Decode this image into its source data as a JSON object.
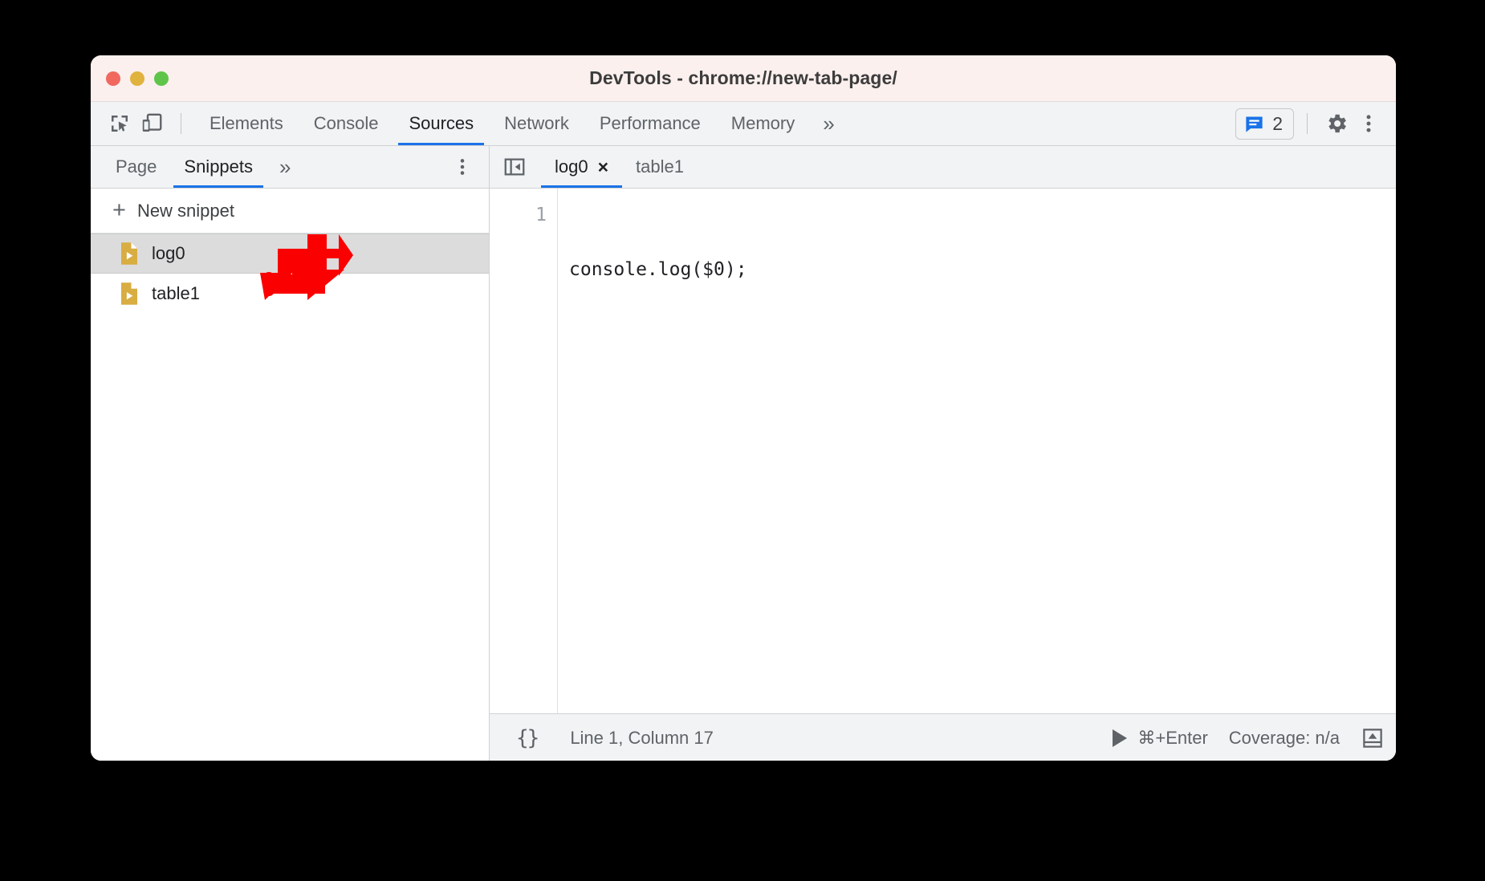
{
  "window": {
    "title": "DevTools - chrome://new-tab-page/",
    "traffic_lights": [
      "close",
      "minimize",
      "maximize"
    ],
    "colors": {
      "titlebar_bg": "#fbf0ee",
      "toolbar_bg": "#f1f3f4",
      "accent": "#1a73e8",
      "selection_bg": "#dcdcdc",
      "snippet_icon": "#d8ad42",
      "annotation_arrow": "#fa0000"
    }
  },
  "toolbar": {
    "inspect_icon": "inspect-element-icon",
    "device_icon": "device-toolbar-icon",
    "tabs": [
      {
        "label": "Elements",
        "active": false
      },
      {
        "label": "Console",
        "active": false
      },
      {
        "label": "Sources",
        "active": true
      },
      {
        "label": "Network",
        "active": false
      },
      {
        "label": "Performance",
        "active": false
      },
      {
        "label": "Memory",
        "active": false
      }
    ],
    "more_tabs_label": "»",
    "message_count": "2",
    "message_icon": "console-message-icon",
    "settings_icon": "gear-icon",
    "more_options_icon": "three-dot-menu-icon"
  },
  "navigator": {
    "tabs": [
      {
        "label": "Page",
        "active": false
      },
      {
        "label": "Snippets",
        "active": true
      }
    ],
    "more_tabs_label": "»",
    "menu_icon": "three-dot-menu-icon",
    "new_snippet_label": "New snippet",
    "new_snippet_plus": "+",
    "snippets": [
      {
        "label": "log0",
        "selected": true
      },
      {
        "label": "table1",
        "selected": false
      }
    ]
  },
  "editor": {
    "collapse_icon": "collapse-sidebar-icon",
    "tabs": [
      {
        "label": "log0",
        "active": true,
        "closable": true,
        "close_glyph": "×"
      },
      {
        "label": "table1",
        "active": false,
        "closable": false,
        "close_glyph": ""
      }
    ],
    "lines": [
      {
        "number": "1",
        "text": "console.log($0);"
      }
    ]
  },
  "statusbar": {
    "pretty_print_label": "{}",
    "cursor_position": "Line 1, Column 17",
    "run_icon": "play-icon",
    "run_shortcut": "⌘+Enter",
    "coverage_label": "Coverage: n/a",
    "drawer_icon": "drawer-toggle-icon"
  },
  "annotation": {
    "arrow": "red-arrow-pointing-down-left",
    "target": "log0 snippet list item"
  }
}
